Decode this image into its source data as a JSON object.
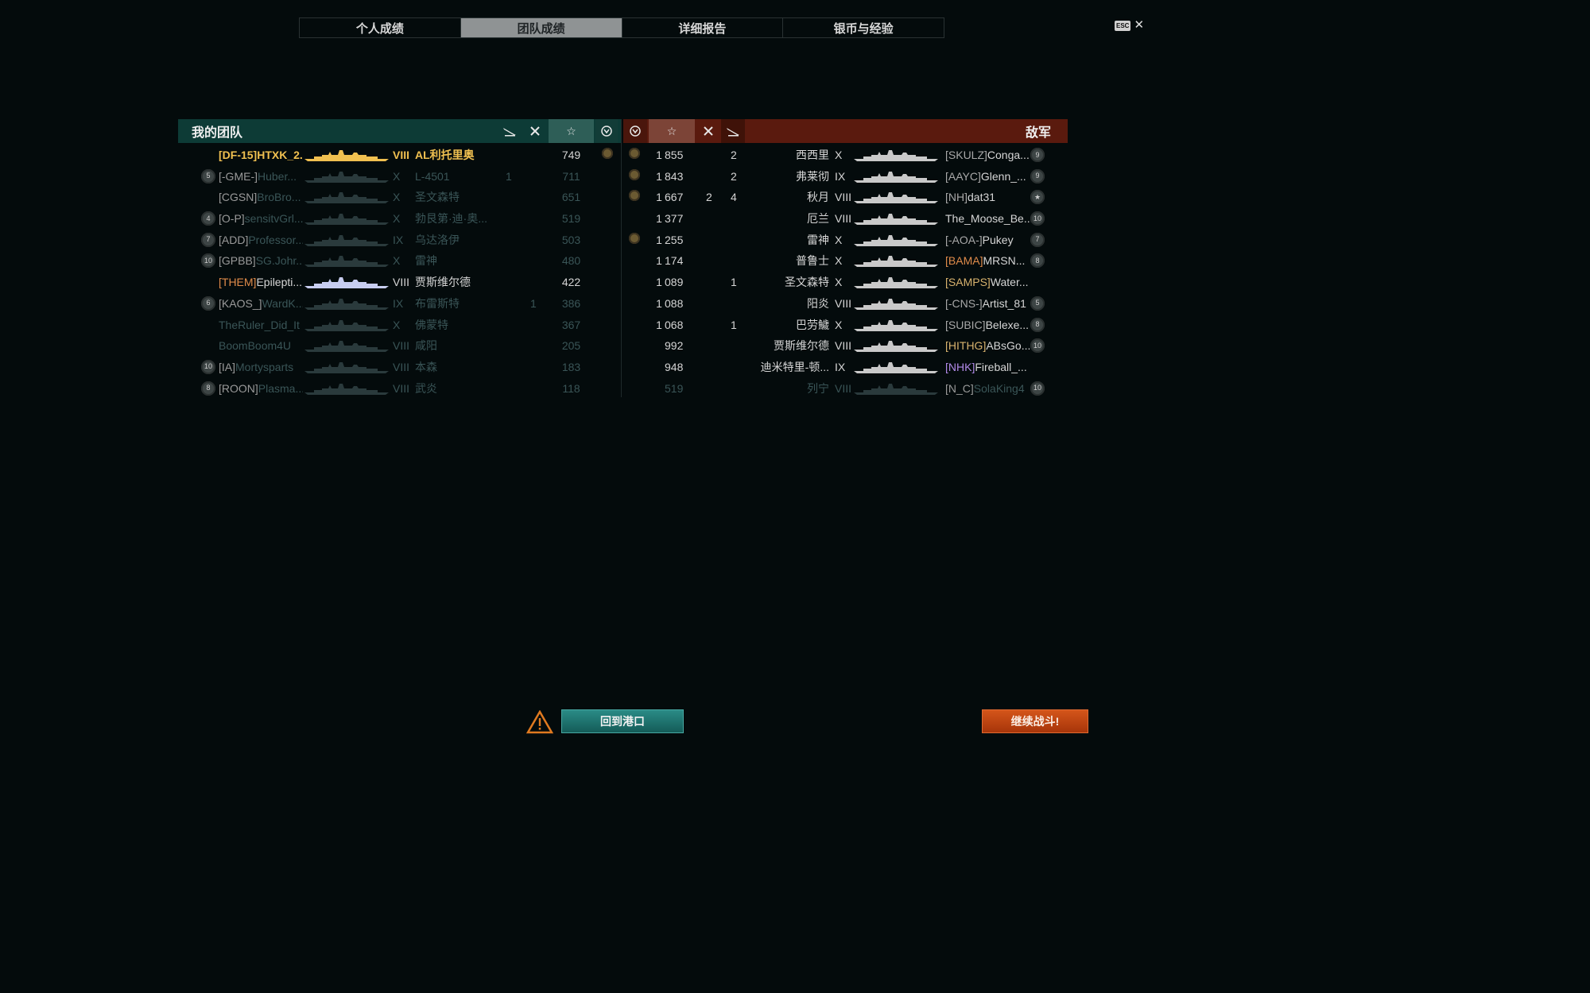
{
  "tabs": [
    {
      "label": "个人成绩",
      "active": false
    },
    {
      "label": "团队成绩",
      "active": true
    },
    {
      "label": "详细报告",
      "active": false
    },
    {
      "label": "银币与经验",
      "active": false
    }
  ],
  "esc": {
    "key": "ESC",
    "close": "✕"
  },
  "left_team": {
    "title": "我的团队",
    "rows": [
      {
        "badge": "",
        "clan": "[DF-15]",
        "name": "HTXK_2...",
        "tier": "VIII",
        "ship": "AL利托里奥",
        "plane": "",
        "cross": "",
        "score": "749",
        "medal": true,
        "alive": true,
        "me": true,
        "clan_color": "me"
      },
      {
        "badge": "5",
        "clan": "[-GME-]",
        "name": "Huber...",
        "tier": "X",
        "ship": "L-4501",
        "plane": "1",
        "cross": "",
        "score": "711",
        "medal": false,
        "alive": false,
        "me": false,
        "clan_color": "grey"
      },
      {
        "badge": "",
        "clan": "[CGSN]",
        "name": "BroBro...",
        "tier": "X",
        "ship": "圣文森特",
        "plane": "",
        "cross": "",
        "score": "651",
        "medal": false,
        "alive": false,
        "me": false,
        "clan_color": "grey"
      },
      {
        "badge": "4",
        "clan": "[O-P]",
        "name": "sensitvGrl...",
        "tier": "X",
        "ship": "勃艮第·迪·奥...",
        "plane": "",
        "cross": "",
        "score": "519",
        "medal": false,
        "alive": false,
        "me": false,
        "clan_color": "grey"
      },
      {
        "badge": "7",
        "clan": "[ADD]",
        "name": "Professor...",
        "tier": "IX",
        "ship": "乌达洛伊",
        "plane": "",
        "cross": "",
        "score": "503",
        "medal": false,
        "alive": false,
        "me": false,
        "clan_color": "grey"
      },
      {
        "badge": "10",
        "clan": "[GPBB]",
        "name": "SG.Johr...",
        "tier": "X",
        "ship": "雷神",
        "plane": "",
        "cross": "",
        "score": "480",
        "medal": false,
        "alive": false,
        "me": false,
        "clan_color": "grey"
      },
      {
        "badge": "",
        "clan": "[THEM]",
        "name": "Epilepti...",
        "tier": "VIII",
        "ship": "贾斯维尔德",
        "plane": "",
        "cross": "",
        "score": "422",
        "medal": false,
        "alive": true,
        "me": false,
        "clan_color": "orange"
      },
      {
        "badge": "6",
        "clan": "[KAOS_]",
        "name": "WardK...",
        "tier": "IX",
        "ship": "布雷斯特",
        "plane": "",
        "cross": "1",
        "score": "386",
        "medal": false,
        "alive": false,
        "me": false,
        "clan_color": "grey"
      },
      {
        "badge": "",
        "clan": "",
        "name": "TheRuler_Did_It",
        "tier": "X",
        "ship": "佛蒙特",
        "plane": "",
        "cross": "",
        "score": "367",
        "medal": false,
        "alive": false,
        "me": false,
        "clan_color": "grey"
      },
      {
        "badge": "",
        "clan": "",
        "name": "BoomBoom4U",
        "tier": "VIII",
        "ship": "咸阳",
        "plane": "",
        "cross": "",
        "score": "205",
        "medal": false,
        "alive": false,
        "me": false,
        "clan_color": "grey"
      },
      {
        "badge": "10",
        "clan": "[IA]",
        "name": "Mortysparts",
        "tier": "VIII",
        "ship": "本森",
        "plane": "",
        "cross": "",
        "score": "183",
        "medal": false,
        "alive": false,
        "me": false,
        "clan_color": "grey"
      },
      {
        "badge": "8",
        "clan": "[ROON]",
        "name": "Plasma...",
        "tier": "VIII",
        "ship": "武炎",
        "plane": "",
        "cross": "",
        "score": "118",
        "medal": false,
        "alive": false,
        "me": false,
        "clan_color": "grey"
      }
    ]
  },
  "right_team": {
    "title": "敌军",
    "rows": [
      {
        "medal": true,
        "pos": "1",
        "score": "855",
        "cross": "",
        "plane": "2",
        "ship": "西西里",
        "tier": "X",
        "clan": "[SKULZ]",
        "name": "Conga...",
        "badge": "9",
        "alive": true,
        "clan_color": "grey"
      },
      {
        "medal": true,
        "pos": "1",
        "score": "843",
        "cross": "",
        "plane": "2",
        "ship": "弗莱彻",
        "tier": "IX",
        "clan": "[AAYC]",
        "name": "Glenn_...",
        "badge": "9",
        "alive": true,
        "clan_color": "grey"
      },
      {
        "medal": true,
        "pos": "1",
        "score": "667",
        "cross": "2",
        "plane": "4",
        "ship": "秋月",
        "tier": "VIII",
        "clan": "[NH]",
        "name": "dat31",
        "badge": "★",
        "alive": true,
        "clan_color": "grey"
      },
      {
        "medal": false,
        "pos": "1",
        "score": "377",
        "cross": "",
        "plane": "",
        "ship": "厄兰",
        "tier": "VIII",
        "clan": "",
        "name": "The_Moose_Be...",
        "badge": "10",
        "alive": true,
        "clan_color": "grey"
      },
      {
        "medal": true,
        "pos": "1",
        "score": "255",
        "cross": "",
        "plane": "",
        "ship": "雷神",
        "tier": "X",
        "clan": "[-AOA-]",
        "name": "Pukey",
        "badge": "7",
        "alive": true,
        "clan_color": "grey"
      },
      {
        "medal": false,
        "pos": "1",
        "score": "174",
        "cross": "",
        "plane": "",
        "ship": "普鲁士",
        "tier": "X",
        "clan": "[BAMA]",
        "name": "MRSN...",
        "badge": "8",
        "alive": true,
        "clan_color": "orange"
      },
      {
        "medal": false,
        "pos": "1",
        "score": "089",
        "cross": "",
        "plane": "1",
        "ship": "圣文森特",
        "tier": "X",
        "clan": "[SAMPS]",
        "name": "Water...",
        "badge": "",
        "alive": true,
        "clan_color": "gold"
      },
      {
        "medal": false,
        "pos": "1",
        "score": "088",
        "cross": "",
        "plane": "",
        "ship": "阳炎",
        "tier": "VIII",
        "clan": "[-CNS-]",
        "name": "Artist_81",
        "badge": "5",
        "alive": true,
        "clan_color": "grey"
      },
      {
        "medal": false,
        "pos": "1",
        "score": "068",
        "cross": "",
        "plane": "1",
        "ship": "巴劳鱥",
        "tier": "X",
        "clan": "[SUBIC]",
        "name": "Belexe...",
        "badge": "8",
        "alive": true,
        "clan_color": "grey"
      },
      {
        "medal": false,
        "pos": "",
        "score": "992",
        "cross": "",
        "plane": "",
        "ship": "贾斯维尔德",
        "tier": "VIII",
        "clan": "[HITHG]",
        "name": "ABsGo...",
        "badge": "10",
        "alive": true,
        "clan_color": "gold"
      },
      {
        "medal": false,
        "pos": "",
        "score": "948",
        "cross": "",
        "plane": "",
        "ship": "迪米特里-顿...",
        "tier": "IX",
        "clan": "[NHK]",
        "name": "Fireball_...",
        "badge": "",
        "alive": true,
        "clan_color": "purple"
      },
      {
        "medal": false,
        "pos": "",
        "score": "519",
        "cross": "",
        "plane": "",
        "ship": "列宁",
        "tier": "VIII",
        "clan": "[N_C]",
        "name": "SolaKing4",
        "badge": "10",
        "alive": false,
        "clan_color": "grey"
      }
    ]
  },
  "footer": {
    "port_button": "回到港口",
    "battle_button": "继续战斗!"
  },
  "colors": {
    "friendly_header": "#0d3b36",
    "enemy_header": "#5a1a0e",
    "me": "#f0c050",
    "port_button": "#1f7a74",
    "battle_button": "#c2440f"
  }
}
